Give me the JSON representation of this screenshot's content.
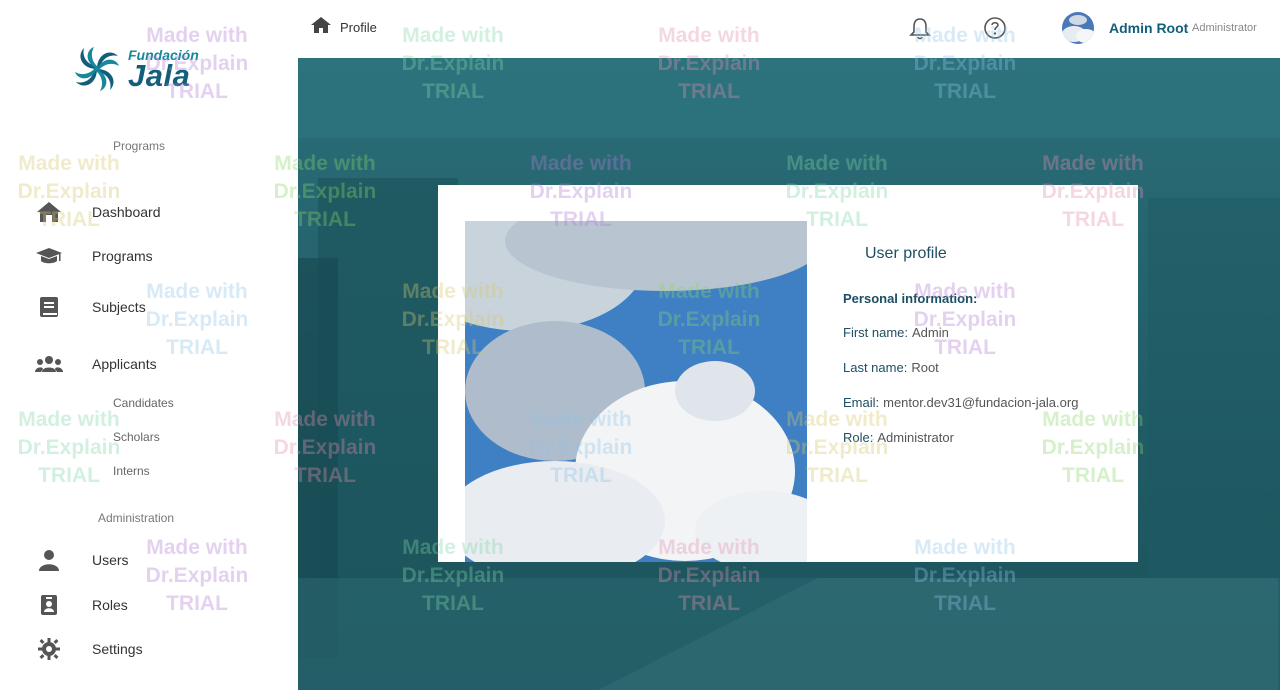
{
  "sidebar": {
    "logo": {
      "small": "Fundación",
      "big": "Jala"
    },
    "programs_section": "Programs",
    "items": [
      {
        "label": "Dashboard",
        "icon": "home-icon"
      },
      {
        "label": "Programs",
        "icon": "graduation-cap-icon"
      },
      {
        "label": "Subjects",
        "icon": "book-icon"
      },
      {
        "label": "Applicants",
        "icon": "users-group-icon"
      }
    ],
    "applicant_subitems": [
      "Candidates",
      "Scholars",
      "Interns"
    ],
    "administration_section": "Administration",
    "admin_items": [
      {
        "label": "Users",
        "icon": "user-icon"
      },
      {
        "label": "Roles",
        "icon": "id-badge-icon"
      },
      {
        "label": "Settings",
        "icon": "gear-icon"
      }
    ]
  },
  "header": {
    "breadcrumb": "Profile",
    "user_name": "Admin Root",
    "user_role": "Administrator"
  },
  "profile": {
    "title": "User profile",
    "personal_info_label": "Personal information:",
    "first_name_label": "First name:",
    "first_name": "Admin",
    "last_name_label": "Last name:",
    "last_name": "Root",
    "email_label": "Email:",
    "email": "mentor.dev31@fundacion-jala.org",
    "role_label": "Role:",
    "role": "Administrator"
  },
  "watermark": {
    "line1": "Made with",
    "line2": "Dr.Explain",
    "line3": "TRIAL"
  },
  "colors": {
    "accent": "#135e7a",
    "overlay": "#25636d"
  }
}
